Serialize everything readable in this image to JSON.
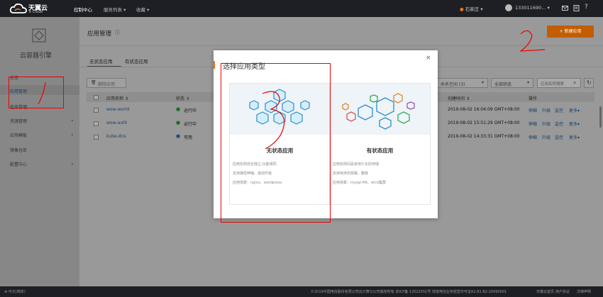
{
  "topbar": {
    "brand": "天翼云",
    "brand_en": "e Cloud",
    "nav": [
      "控制中心",
      "服务列表",
      "收藏"
    ],
    "region": "石家庄",
    "user": "133011690...",
    "chev": "▾"
  },
  "sidebar": {
    "title": "云容器引擎",
    "items": [
      "总览",
      "应用管理",
      "任务管理",
      "资源管理",
      "应用模板",
      "镜像仓库",
      "配置中心"
    ]
  },
  "main": {
    "title": "应用管理",
    "create_button": "+ 新建应用",
    "tabs": [
      "无状态应用",
      "有状态应用"
    ],
    "delete_button": "删除应用",
    "filters": {
      "namespace": "命名空间 (3)",
      "status": "全部状态",
      "search_placeholder": "应用名称搜索"
    },
    "columns": [
      "应用名称",
      "状态",
      "创建时间",
      "操作"
    ],
    "rows": [
      {
        "name": "wow-world",
        "status": "运行中",
        "time": "2019-08-02 16:04:09 GMT+08:00"
      },
      {
        "name": "wow-auth",
        "status": "运行中",
        "time": "2019-08-02 15:51:29 GMT+08:00"
      },
      {
        "name": "kube-dns",
        "status": "可用",
        "time": "2019-08-02 14:33:31 GMT+08:00"
      }
    ],
    "actions": [
      "伸缩",
      "升级",
      "监控",
      "更多"
    ]
  },
  "modal": {
    "title": "选择应用类型",
    "close": "×",
    "cards": [
      {
        "name": "无状态应用",
        "lines": [
          "应用实例完全独立,功能相同",
          "支持弹性伸缩、滚动升级",
          "应用场景：nginx、wordpress"
        ]
      },
      {
        "name": "有状态应用",
        "lines": [
          "应用实例间具有持久化的存储",
          "支持有序的部署、删除",
          "应用场景：mysql-HA、etcd集群"
        ]
      }
    ]
  },
  "footer": {
    "lang": "中文(简体)",
    "copyright": "©2019中国电信股份有限公司云计算分公司版权所有  京ICP备 12022551号  增值电信业务经营许可证A2.B1.B2-20090001",
    "links": [
      "天翼云首页",
      "用户协议",
      "法律声明"
    ]
  },
  "colors": {
    "accent": "#e8731a",
    "link": "#1f6fb8",
    "topbar": "#1d1f24"
  }
}
